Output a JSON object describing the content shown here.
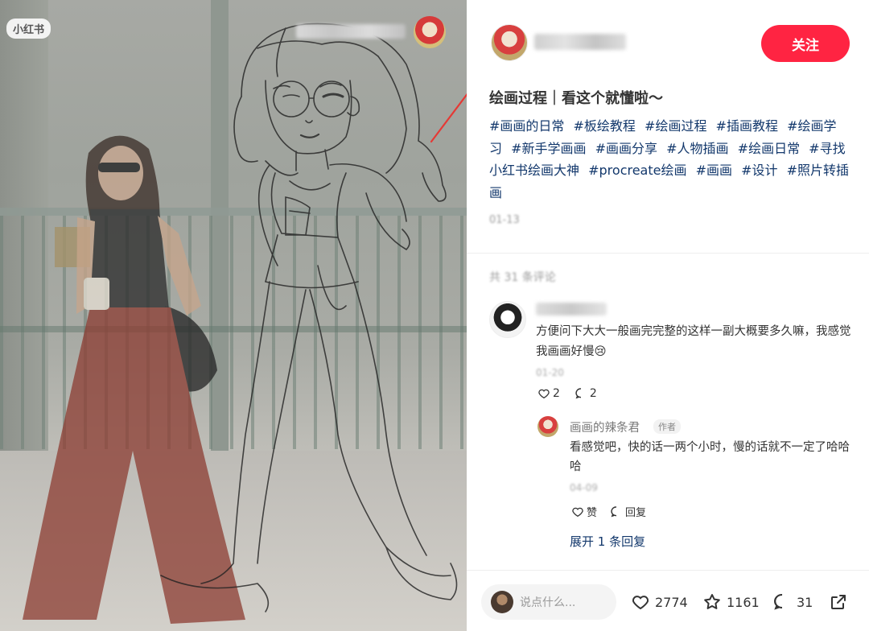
{
  "image_panel": {
    "logo_text": "小红书"
  },
  "author": {
    "follow_label": "关注"
  },
  "note": {
    "title": "绘画过程｜看这个就懂啦～",
    "tags": [
      "#画画的日常",
      "#板绘教程",
      "#绘画过程",
      "#插画教程",
      "#绘画学习",
      "#新手学画画",
      "#画画分享",
      "#人物插画",
      "#绘画日常",
      "#寻找小红书绘画大神",
      "#procreate绘画",
      "#画画",
      "#设计",
      "#照片转插画"
    ],
    "date": "01-13"
  },
  "comments": {
    "count_text": "共 31 条评论",
    "items": [
      {
        "text": "方便问下大大一般画完完整的这样一副大概要多久嘛，我感觉我画画好慢😢",
        "date": "01-20",
        "likes": "2",
        "replies_count": "2",
        "reply": {
          "author": "画画的辣条君",
          "author_tag": "作者",
          "text": "看感觉吧，快的话一两个小时，慢的话就不一定了哈哈哈",
          "date": "04-09",
          "like_label": "赞",
          "reply_label": "回复"
        }
      }
    ],
    "expand_label": "展开 1 条回复"
  },
  "bottom_bar": {
    "input_placeholder": "说点什么...",
    "likes": "2774",
    "collects": "1161",
    "comments": "31"
  },
  "colors": {
    "accent": "#ff2442",
    "tag_link": "#13386c",
    "annotation_arrow": "#e53935"
  },
  "icons": [
    "heart-icon",
    "star-icon",
    "comment-icon",
    "share-icon"
  ]
}
